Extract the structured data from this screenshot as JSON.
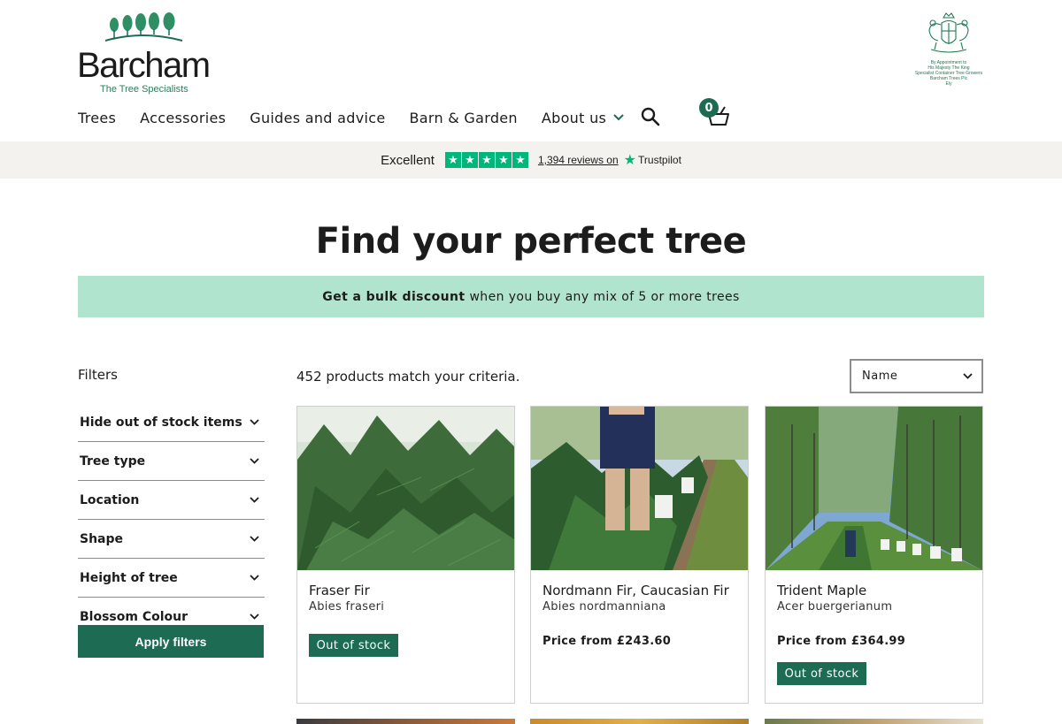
{
  "brand": {
    "name": "Barcham",
    "tagline": "The Tree Specialists"
  },
  "royal_warrant": {
    "lines": [
      "By Appointment to",
      "His Majesty The King",
      "Specialist Container Tree Growers",
      "Barcham Trees Plc",
      "Ely"
    ]
  },
  "nav": {
    "items": [
      {
        "label": "Trees"
      },
      {
        "label": "Accessories"
      },
      {
        "label": "Guides and advice"
      },
      {
        "label": "Barn & Garden"
      },
      {
        "label": "About us"
      }
    ],
    "basket_count": "0"
  },
  "trustpilot": {
    "rating_label": "Excellent",
    "reviews": "1,394 reviews on",
    "brand": "Trustpilot"
  },
  "page": {
    "title": "Find your perfect tree",
    "banner_bold": "Get a bulk discount",
    "banner_rest": "when you buy any mix of 5 or more trees"
  },
  "filters": {
    "title": "Filters",
    "items": [
      {
        "label": "Hide out of stock items"
      },
      {
        "label": "Tree type"
      },
      {
        "label": "Location"
      },
      {
        "label": "Shape"
      },
      {
        "label": "Height of tree"
      },
      {
        "label": "Blossom Colour"
      }
    ],
    "apply_label": "Apply filters"
  },
  "results": {
    "count_text": "452 products match your criteria.",
    "sort_selected": "Name"
  },
  "products": [
    {
      "name": "Fraser Fir",
      "latin": "Abies fraseri",
      "price": "",
      "stock": "Out of stock"
    },
    {
      "name": "Nordmann Fir, Caucasian Fir",
      "latin": "Abies nordmanniana",
      "price": "Price from £243.60",
      "stock": ""
    },
    {
      "name": "Trident Maple",
      "latin": "Acer buergerianum",
      "price": "Price from £364.99",
      "stock": "Out of stock"
    }
  ],
  "colors": {
    "brand_green": "#1d6b53",
    "banner_mint": "#b1e4cf",
    "trustpilot_green": "#00b67a"
  }
}
